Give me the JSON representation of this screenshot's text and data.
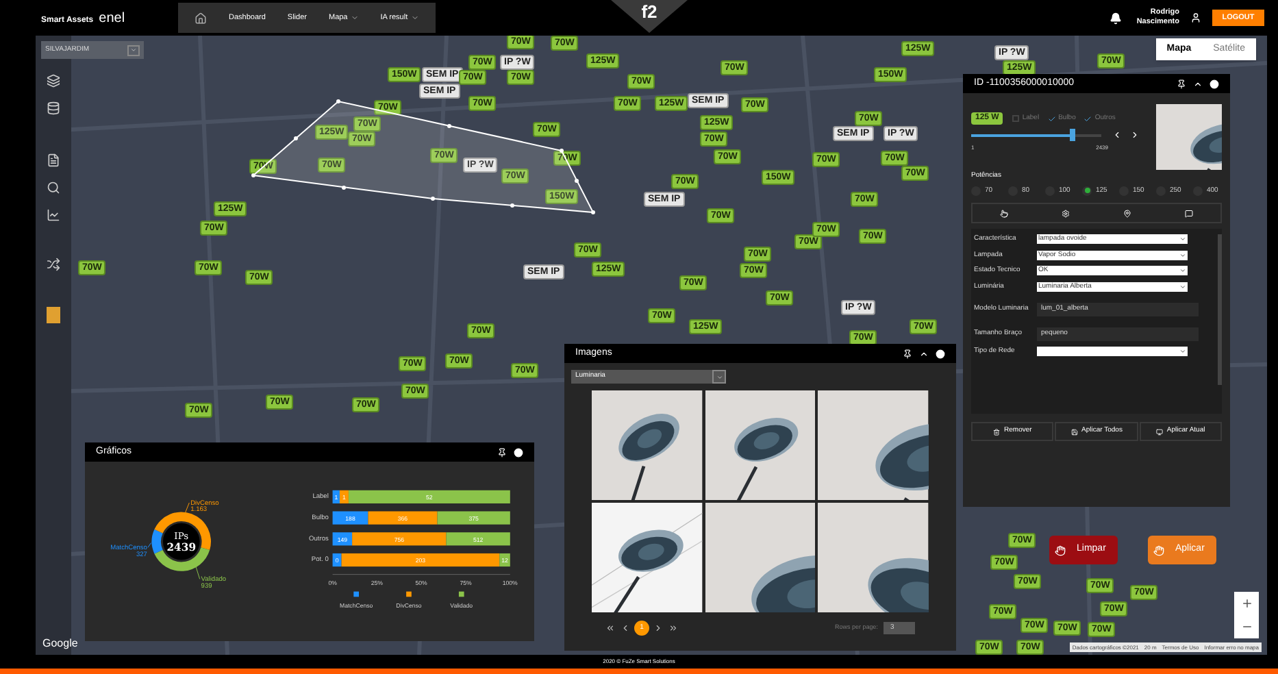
{
  "topbar": {
    "brand": "Smart Assets",
    "brand_mark": "enel",
    "nav": [
      {
        "label": "Dashboard",
        "dropdown": false
      },
      {
        "label": "Slider",
        "dropdown": false
      },
      {
        "label": "Mapa",
        "dropdown": true
      },
      {
        "label": "IA result",
        "dropdown": true
      }
    ],
    "center_logo": "f2",
    "user": "Rodrigo Nascimento",
    "logout": "LOGOUT"
  },
  "map": {
    "search_value": "SILVAJARDIM",
    "map_types": [
      {
        "label": "Mapa",
        "selected": true
      },
      {
        "label": "Satélite",
        "selected": false
      }
    ],
    "markers": [
      {
        "label": "70W",
        "kind": "power"
      },
      {
        "label": "70W",
        "kind": "power"
      },
      {
        "label": "70W",
        "kind": "power"
      },
      {
        "label": "IP ?W",
        "kind": "unknown"
      },
      {
        "label": "125W",
        "kind": "power"
      },
      {
        "label": "150W",
        "kind": "power"
      },
      {
        "label": "SEM IP",
        "kind": "unknown"
      },
      {
        "label": "70W",
        "kind": "power"
      },
      {
        "label": "70W",
        "kind": "power"
      },
      {
        "label": "SEM IP",
        "kind": "unknown"
      },
      {
        "label": "70W",
        "kind": "power"
      },
      {
        "label": "70W",
        "kind": "power"
      },
      {
        "label": "70W",
        "kind": "power"
      },
      {
        "label": "125W",
        "kind": "power"
      },
      {
        "label": "70W",
        "kind": "power"
      },
      {
        "label": "70W",
        "kind": "power"
      },
      {
        "label": "70W",
        "kind": "power"
      },
      {
        "label": "IP ?W",
        "kind": "unknown"
      },
      {
        "label": "70W",
        "kind": "power"
      },
      {
        "label": "70W",
        "kind": "power"
      },
      {
        "label": "70W",
        "kind": "power"
      },
      {
        "label": "70W",
        "kind": "power"
      },
      {
        "label": "150W",
        "kind": "power"
      },
      {
        "label": "125W",
        "kind": "power"
      },
      {
        "label": "70W",
        "kind": "power"
      },
      {
        "label": "70W",
        "kind": "power"
      },
      {
        "label": "70W",
        "kind": "power"
      },
      {
        "label": "70W",
        "kind": "power"
      },
      {
        "label": "SEM IP",
        "kind": "unknown"
      },
      {
        "label": "SEM IP",
        "kind": "unknown"
      },
      {
        "label": "70W",
        "kind": "power"
      },
      {
        "label": "125W",
        "kind": "power"
      },
      {
        "label": "70W",
        "kind": "power"
      },
      {
        "label": "70W",
        "kind": "power"
      },
      {
        "label": "70W",
        "kind": "power"
      },
      {
        "label": "125W",
        "kind": "power"
      },
      {
        "label": "SEM IP",
        "kind": "unknown"
      },
      {
        "label": "70W",
        "kind": "power"
      },
      {
        "label": "70W",
        "kind": "power"
      },
      {
        "label": "125W",
        "kind": "power"
      },
      {
        "label": "70W",
        "kind": "power"
      },
      {
        "label": "70W",
        "kind": "power"
      },
      {
        "label": "150W",
        "kind": "power"
      },
      {
        "label": "70W",
        "kind": "power"
      },
      {
        "label": "70W",
        "kind": "power"
      },
      {
        "label": "70W",
        "kind": "power"
      },
      {
        "label": "70W",
        "kind": "power"
      },
      {
        "label": "70W",
        "kind": "power"
      },
      {
        "label": "70W",
        "kind": "power"
      },
      {
        "label": "70W",
        "kind": "power"
      },
      {
        "label": "SEM IP",
        "kind": "unknown"
      },
      {
        "label": "IP ?W",
        "kind": "unknown"
      },
      {
        "label": "70W",
        "kind": "power"
      },
      {
        "label": "150W",
        "kind": "power"
      },
      {
        "label": "125W",
        "kind": "power"
      },
      {
        "label": "70W",
        "kind": "power"
      },
      {
        "label": "70W",
        "kind": "power"
      },
      {
        "label": "70W",
        "kind": "power"
      },
      {
        "label": "70W",
        "kind": "power"
      },
      {
        "label": "70W",
        "kind": "power"
      },
      {
        "label": "IP ?W",
        "kind": "unknown"
      },
      {
        "label": "70W",
        "kind": "power"
      },
      {
        "label": "125W",
        "kind": "power"
      },
      {
        "label": "70W",
        "kind": "power"
      },
      {
        "label": "70W",
        "kind": "power"
      },
      {
        "label": "70W",
        "kind": "power"
      },
      {
        "label": "70W",
        "kind": "power"
      },
      {
        "label": "70W",
        "kind": "power"
      },
      {
        "label": "70W",
        "kind": "power"
      },
      {
        "label": "70W",
        "kind": "power"
      },
      {
        "label": "70W",
        "kind": "power"
      },
      {
        "label": "70W",
        "kind": "power"
      },
      {
        "label": "70W",
        "kind": "power"
      },
      {
        "label": "IP ?W",
        "kind": "unknown"
      },
      {
        "label": "125W",
        "kind": "power"
      },
      {
        "label": "70W",
        "kind": "power"
      },
      {
        "label": "70W",
        "kind": "power"
      },
      {
        "label": "70W",
        "kind": "power"
      },
      {
        "label": "70W",
        "kind": "power"
      },
      {
        "label": "70W",
        "kind": "power"
      },
      {
        "label": "70W",
        "kind": "power"
      },
      {
        "label": "70W",
        "kind": "power"
      },
      {
        "label": "70W",
        "kind": "power"
      },
      {
        "label": "70W",
        "kind": "power"
      },
      {
        "label": "70W",
        "kind": "power"
      },
      {
        "label": "70W",
        "kind": "power"
      },
      {
        "label": "70W",
        "kind": "power"
      },
      {
        "label": "70W",
        "kind": "power"
      }
    ],
    "action_buttons": [
      {
        "label": "Limpar",
        "kind": "danger"
      },
      {
        "label": "Aplicar",
        "kind": "primary"
      }
    ],
    "google": "Google",
    "attribution": [
      "Dados cartográficos ©2021",
      "20 m",
      "Termos de Uso",
      "Informar erro no mapa"
    ]
  },
  "charts_panel": {
    "title": "Gráficos",
    "donut_total": "2439",
    "chart_data": [
      {
        "type": "donut",
        "categories": [
          "MatchCenso",
          "DivCenso",
          "Validado"
        ],
        "colors": [
          "#1e90ff",
          "#ff9800",
          "#8bc34a"
        ],
        "series": [
          {
            "name": "IPs",
            "values": [
              13.5,
              47.9,
              38.6
            ]
          }
        ],
        "value_labels": [
          "327",
          "1.163",
          "939"
        ]
      },
      {
        "type": "bar",
        "orientation": "horizontal",
        "stacked": true,
        "categories": [
          "Label",
          "Bulbo",
          "Outros",
          "Pot. 0"
        ],
        "series": [
          {
            "name": "MatchCenso",
            "color": "#1e90ff",
            "values": [
              0.04,
              0.2,
              0.11,
              0.05
            ]
          },
          {
            "name": "DivCenso",
            "color": "#ff9800",
            "values": [
              0.05,
              0.39,
              0.53,
              0.89
            ]
          },
          {
            "name": "Validado",
            "color": "#8bc34a",
            "values": [
              0.91,
              0.41,
              0.36,
              0.06
            ]
          }
        ],
        "legend": "bottom",
        "value_labels": [
          [
            "1",
            "188",
            "149",
            "0"
          ],
          [
            "1",
            "366",
            "756",
            "203"
          ],
          [
            "52",
            "375",
            "512",
            "12"
          ]
        ],
        "xlim": [
          0,
          1
        ],
        "xticks": [
          {
            "value": 0,
            "label": "0%"
          },
          {
            "value": 0.25,
            "label": "25%"
          },
          {
            "value": 0.5,
            "label": "50%"
          },
          {
            "value": 0.75,
            "label": "75%"
          },
          {
            "value": 1,
            "label": "100%"
          }
        ]
      }
    ]
  },
  "image_panel": {
    "title": "Imagens",
    "category": "Luminaria",
    "page": "1",
    "rows_per_page_label": "Rows per page:",
    "rows_per_page": "3"
  },
  "detail_panel": {
    "id": "ID -1100356000010000",
    "power_badge": "125 W",
    "filters": [
      {
        "label": "Label",
        "checked": false
      },
      {
        "label": "Bulbo",
        "checked": true
      },
      {
        "label": "Outros",
        "checked": true
      }
    ],
    "slider": {
      "level": 0.78,
      "min": "1",
      "max": "2439"
    },
    "potencias_label": "Potências",
    "potencias": [
      {
        "label": "70",
        "selected": false
      },
      {
        "label": "80",
        "selected": false
      },
      {
        "label": "100",
        "selected": false
      },
      {
        "label": "125",
        "selected": true
      },
      {
        "label": "150",
        "selected": false
      },
      {
        "label": "250",
        "selected": false
      },
      {
        "label": "400",
        "selected": false
      }
    ],
    "fields": [
      {
        "label": "Característica",
        "value": "lampada ovoide",
        "kind": "select"
      },
      {
        "label": "Lampada",
        "value": "Vapor Sodio",
        "kind": "select"
      },
      {
        "label": "Estado Tecnico",
        "value": "OK",
        "kind": "select"
      },
      {
        "label": "Luminária",
        "value": "Luminaria Alberta",
        "kind": "select"
      },
      {
        "label": "Modelo Luminaria",
        "value": "lum_01_alberta",
        "kind": "text"
      },
      {
        "label": "Tamanho Braço",
        "value": "pequeno",
        "kind": "text"
      },
      {
        "label": "Tipo de Rede",
        "kind": "select"
      }
    ],
    "buttons": [
      "Remover",
      "Aplicar Todos",
      "Aplicar Atual"
    ]
  },
  "footer": "2020 © FuZe Smart Solutions"
}
